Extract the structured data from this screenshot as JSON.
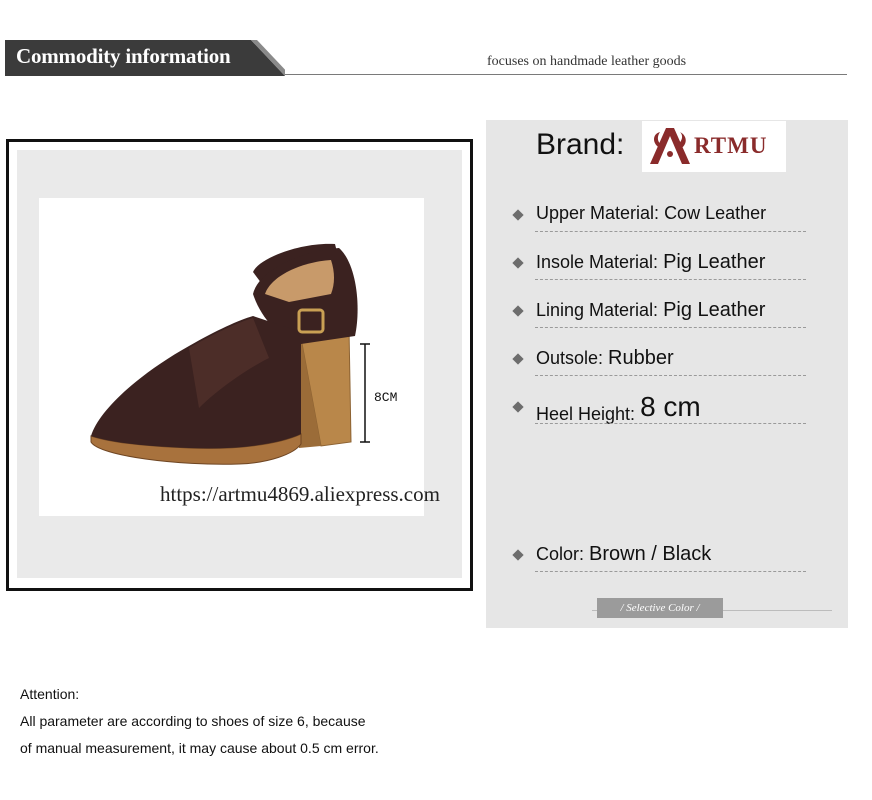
{
  "header": {
    "title": "Commodity information",
    "tagline": "focuses on handmade leather goods"
  },
  "product": {
    "height_note": "8CM",
    "watermark": "https://artmu4869.aliexpress.com"
  },
  "specs": {
    "brand_label": "Brand:",
    "brand_logo_text": "RTMU",
    "items": [
      {
        "label": "Upper Material: ",
        "value": "Cow Leather"
      },
      {
        "label": "Insole Material: ",
        "value": "Pig Leather"
      },
      {
        "label": "Lining Material: ",
        "value": "Pig Leather"
      },
      {
        "label": "Outsole: ",
        "value": "Rubber"
      },
      {
        "label": "Heel Height:  ",
        "value": "8 cm"
      },
      {
        "label": "Color:  ",
        "value": "Brown / Black"
      }
    ],
    "selective_color": "/ Selective Color /"
  },
  "attention": {
    "title": "Attention:",
    "line1": "All parameter are according to shoes of size 6, because",
    "line2": "of manual measurement, it may cause about 0.5 cm error."
  },
  "colors": {
    "leather": "#3b2220",
    "heel": "#b9874a",
    "logo": "#8a2b2b",
    "panel": "#e6e6e6"
  }
}
